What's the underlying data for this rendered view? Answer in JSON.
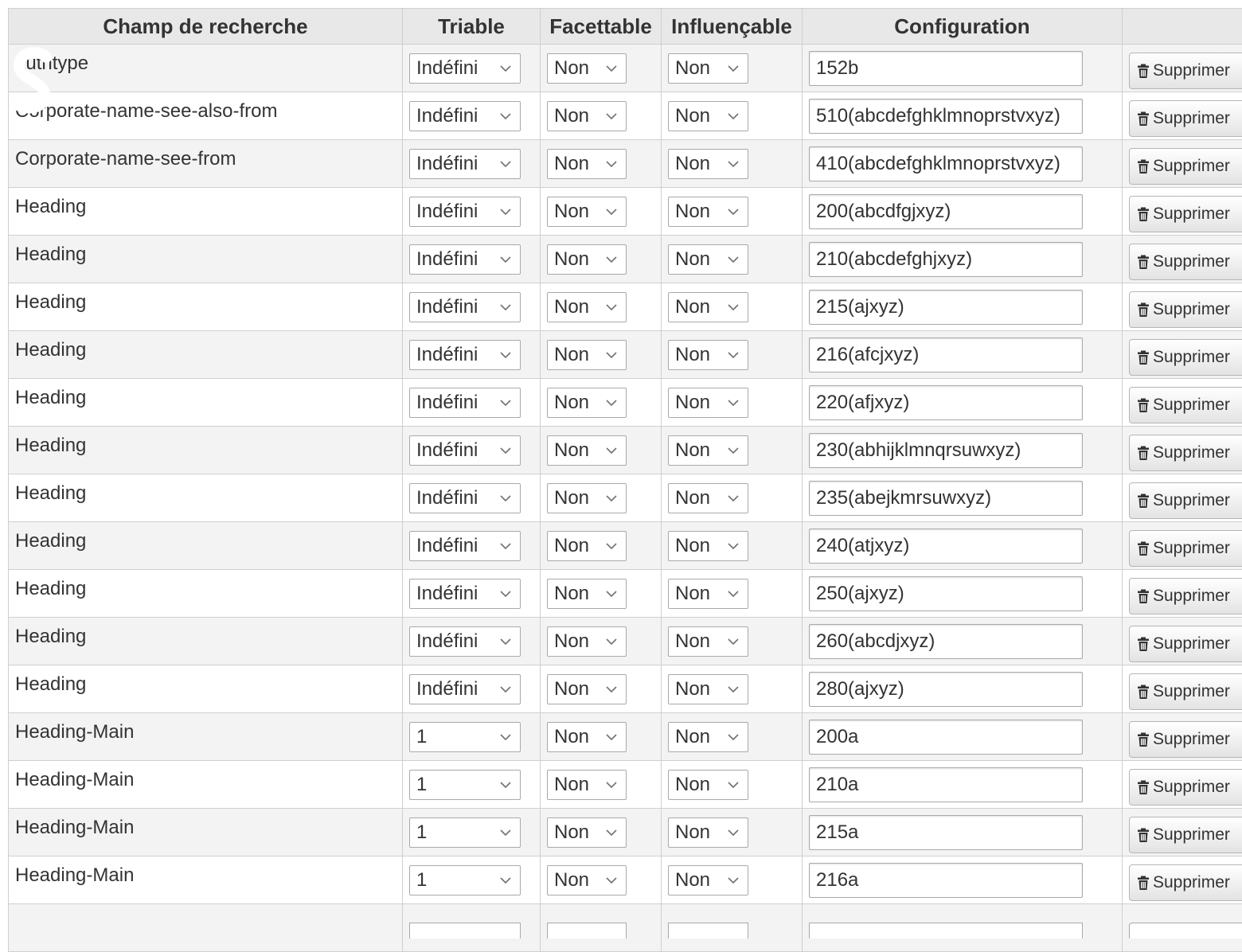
{
  "table": {
    "headers": {
      "field": "Champ de recherche",
      "sortable": "Triable",
      "facetable": "Facettable",
      "boostable": "Influençable",
      "configuration": "Configuration",
      "actions": ""
    },
    "delete_label": "Supprimer",
    "rows": [
      {
        "field": "authtype",
        "sortable": "Indéfini",
        "facetable": "Non",
        "boostable": "Non",
        "configuration": "152b"
      },
      {
        "field": "Corporate-name-see-also-from",
        "sortable": "Indéfini",
        "facetable": "Non",
        "boostable": "Non",
        "configuration": "510(abcdefghklmnoprstvxyz)"
      },
      {
        "field": "Corporate-name-see-from",
        "sortable": "Indéfini",
        "facetable": "Non",
        "boostable": "Non",
        "configuration": "410(abcdefghklmnoprstvxyz)"
      },
      {
        "field": "Heading",
        "sortable": "Indéfini",
        "facetable": "Non",
        "boostable": "Non",
        "configuration": "200(abcdfgjxyz)"
      },
      {
        "field": "Heading",
        "sortable": "Indéfini",
        "facetable": "Non",
        "boostable": "Non",
        "configuration": "210(abcdefghjxyz)"
      },
      {
        "field": "Heading",
        "sortable": "Indéfini",
        "facetable": "Non",
        "boostable": "Non",
        "configuration": "215(ajxyz)"
      },
      {
        "field": "Heading",
        "sortable": "Indéfini",
        "facetable": "Non",
        "boostable": "Non",
        "configuration": "216(afcjxyz)"
      },
      {
        "field": "Heading",
        "sortable": "Indéfini",
        "facetable": "Non",
        "boostable": "Non",
        "configuration": "220(afjxyz)"
      },
      {
        "field": "Heading",
        "sortable": "Indéfini",
        "facetable": "Non",
        "boostable": "Non",
        "configuration": "230(abhijklmnqrsuwxyz)"
      },
      {
        "field": "Heading",
        "sortable": "Indéfini",
        "facetable": "Non",
        "boostable": "Non",
        "configuration": "235(abejkmrsuwxyz)"
      },
      {
        "field": "Heading",
        "sortable": "Indéfini",
        "facetable": "Non",
        "boostable": "Non",
        "configuration": "240(atjxyz)"
      },
      {
        "field": "Heading",
        "sortable": "Indéfini",
        "facetable": "Non",
        "boostable": "Non",
        "configuration": "250(ajxyz)"
      },
      {
        "field": "Heading",
        "sortable": "Indéfini",
        "facetable": "Non",
        "boostable": "Non",
        "configuration": "260(abcdjxyz)"
      },
      {
        "field": "Heading",
        "sortable": "Indéfini",
        "facetable": "Non",
        "boostable": "Non",
        "configuration": "280(ajxyz)"
      },
      {
        "field": "Heading-Main",
        "sortable": "1",
        "facetable": "Non",
        "boostable": "Non",
        "configuration": "200a"
      },
      {
        "field": "Heading-Main",
        "sortable": "1",
        "facetable": "Non",
        "boostable": "Non",
        "configuration": "210a"
      },
      {
        "field": "Heading-Main",
        "sortable": "1",
        "facetable": "Non",
        "boostable": "Non",
        "configuration": "215a"
      },
      {
        "field": "Heading-Main",
        "sortable": "1",
        "facetable": "Non",
        "boostable": "Non",
        "configuration": "216a"
      }
    ]
  }
}
